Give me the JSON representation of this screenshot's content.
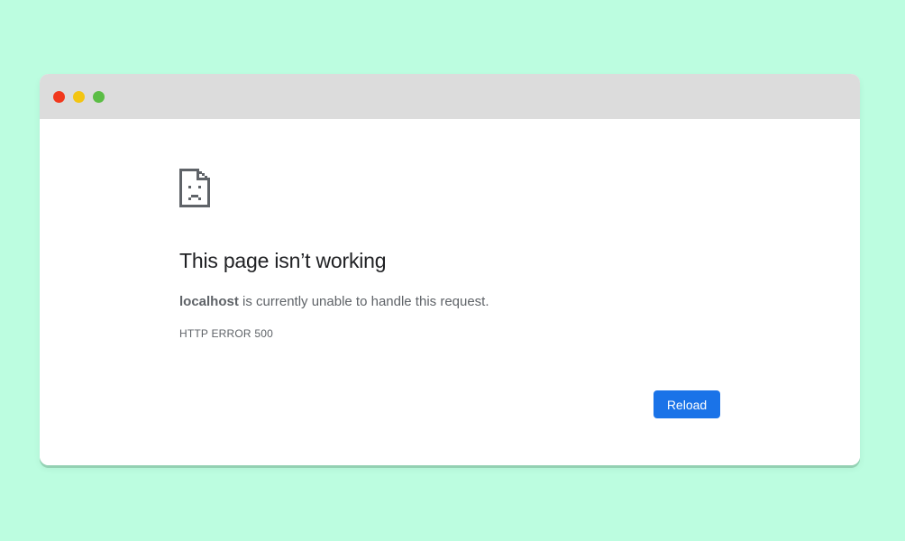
{
  "window": {
    "traffic_lights": [
      {
        "name": "close",
        "color": "#f1381d"
      },
      {
        "name": "minimize",
        "color": "#f3c512"
      },
      {
        "name": "zoom",
        "color": "#5bbd45"
      }
    ]
  },
  "error_page": {
    "icon": "sad-document-icon",
    "title": "This page isn’t working",
    "host": "localhost",
    "message_suffix": " is currently unable to handle this request.",
    "error_code": "HTTP ERROR 500",
    "reload_label": "Reload"
  },
  "colors": {
    "background": "#bcfde0",
    "titlebar": "#dcdcdc",
    "button": "#1a73e8",
    "text_primary": "#202124",
    "text_secondary": "#5f6368"
  }
}
